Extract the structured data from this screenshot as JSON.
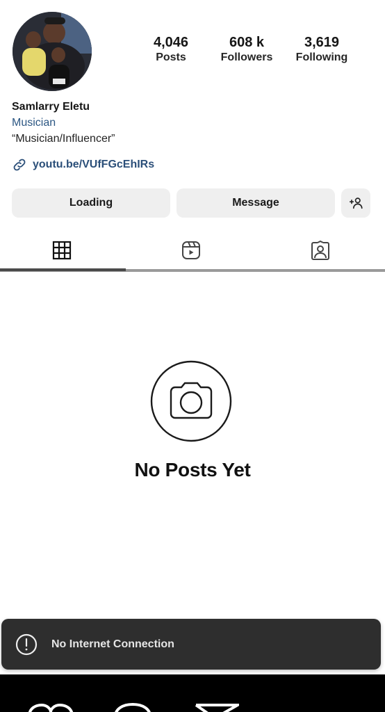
{
  "profile": {
    "name": "Samlarry Eletu",
    "category": "Musician",
    "tagline": "“Musician/Influencer”",
    "link": "youtu.be/VUfFGcEhIRs"
  },
  "stats": {
    "posts": {
      "value": "4,046",
      "label": "Posts"
    },
    "followers": {
      "value": "608 k",
      "label": "Followers"
    },
    "following": {
      "value": "3,619",
      "label": "Following"
    }
  },
  "actions": {
    "primary_label": "Loading",
    "message_label": "Message",
    "suggest_icon": "add-person-icon"
  },
  "tabs": [
    {
      "name": "posts",
      "icon": "grid-icon",
      "active": true
    },
    {
      "name": "reels",
      "icon": "reels-icon",
      "active": false
    },
    {
      "name": "tagged",
      "icon": "tagged-person-icon",
      "active": false
    }
  ],
  "empty_state": {
    "icon": "camera-icon",
    "title": "No Posts Yet"
  },
  "toast": {
    "icon": "alert-circle-icon",
    "message": "No Internet Connection"
  },
  "bottom_bar": {
    "icons": [
      "heart-icon",
      "comment-icon",
      "share-icon"
    ]
  },
  "colors": {
    "category_text": "#2c5783",
    "link_text": "#2b4f79",
    "button_bg": "#efefef",
    "toast_bg": "#2e2e2e"
  }
}
